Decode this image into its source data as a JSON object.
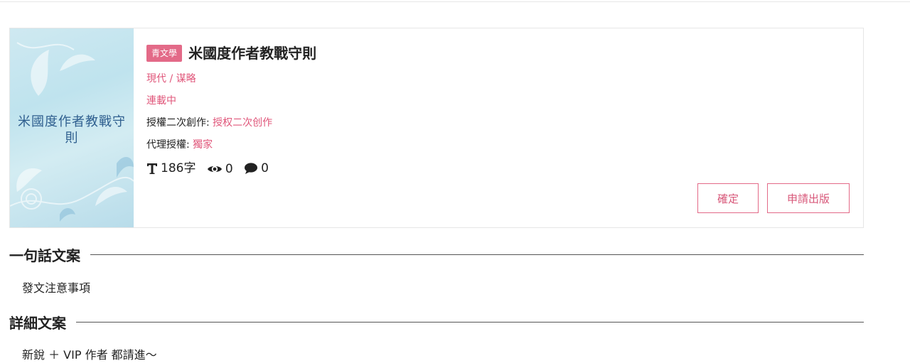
{
  "book": {
    "cover_title": "米國度作者教戰守則",
    "tag": "青文學",
    "title": "米國度作者教戰守則",
    "genre": "現代 / 谋略",
    "status": "連載中",
    "derivative_label": "授權二次創作:",
    "derivative_value": "授权二次创作",
    "agency_label": "代理授權:",
    "agency_value": "獨家",
    "word_count": "186字",
    "views": "0",
    "comments": "0"
  },
  "buttons": {
    "confirm": "確定",
    "publish": "申請出版"
  },
  "sections": {
    "one_line_title": "一句話文案",
    "one_line_text": "發文注意事項",
    "detail_title": "詳細文案",
    "detail_text": "新銳 ＋ VIP 作者 都請進～"
  },
  "colors": {
    "accent": "#e36a88",
    "accent_text": "#e0567a",
    "cover_text": "#2f5f8f"
  },
  "icons": [
    "text-size-icon",
    "eye-icon",
    "comment-icon"
  ]
}
